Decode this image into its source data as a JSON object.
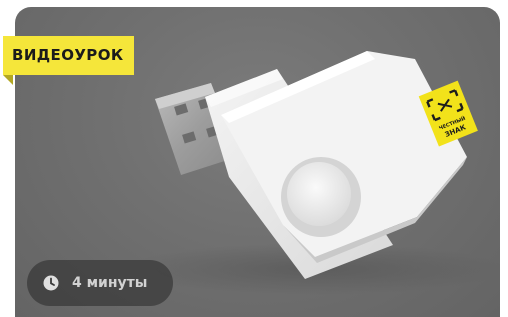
{
  "card": {
    "badge_label": "ВИДЕОУРОК",
    "duration_label": "4 минуты",
    "duration_icon": "clock-icon",
    "logo_text": [
      "ЧЕСТНЫЙ",
      "ЗНАК"
    ]
  },
  "colors": {
    "badge_background": "#f5e63a",
    "photo_background": "#6e6e6e",
    "pill_background": "#3a3a3a",
    "pill_text": "#d2d2d2",
    "logo_yellow": "#f2e21a"
  }
}
